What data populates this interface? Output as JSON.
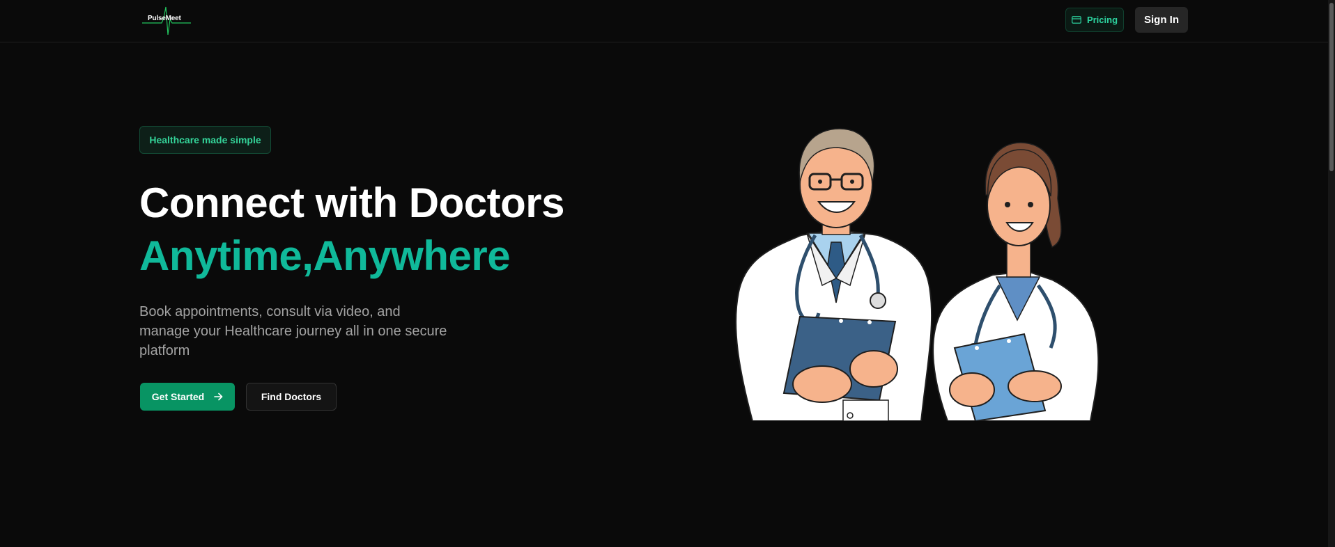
{
  "header": {
    "logo_text": "PulseMeet",
    "pricing_label": "Pricing",
    "signin_label": "Sign In"
  },
  "hero": {
    "badge": "Healthcare made simple",
    "title_line1": "Connect with Doctors",
    "title_line2": "Anytime,Anywhere",
    "description": "Book appointments, consult via video, and manage your Healthcare journey all in one secure platform",
    "primary_cta": "Get Started",
    "secondary_cta": "Find Doctors"
  },
  "icons": {
    "logo": "pulse-line-icon",
    "pricing": "credit-card-icon",
    "cta": "arrow-right-icon"
  },
  "colors": {
    "background": "#0a0a0a",
    "accent": "#10b99a",
    "badge_text": "#34d399",
    "primary_button": "#089463"
  }
}
